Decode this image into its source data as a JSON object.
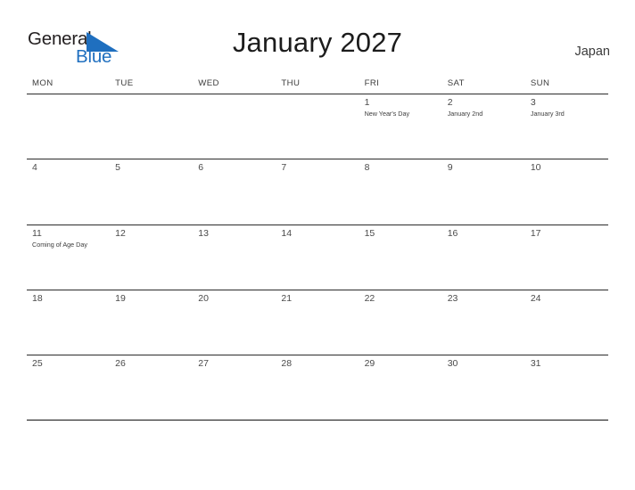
{
  "brand": {
    "name_part1": "General",
    "name_part2": "Blue",
    "triangle_icon": "blue-triangle-icon",
    "blue_color": "#1f6fbf",
    "dark_color": "#231f20"
  },
  "header": {
    "title": "January 2027",
    "country": "Japan"
  },
  "calendar": {
    "month": "January",
    "year": "2027",
    "weekday_headers": [
      "MON",
      "TUE",
      "WED",
      "THU",
      "FRI",
      "SAT",
      "SUN"
    ],
    "weeks": [
      [
        {
          "day": "",
          "event": ""
        },
        {
          "day": "",
          "event": ""
        },
        {
          "day": "",
          "event": ""
        },
        {
          "day": "",
          "event": ""
        },
        {
          "day": "1",
          "event": "New Year's Day"
        },
        {
          "day": "2",
          "event": "January 2nd"
        },
        {
          "day": "3",
          "event": "January 3rd"
        }
      ],
      [
        {
          "day": "4",
          "event": ""
        },
        {
          "day": "5",
          "event": ""
        },
        {
          "day": "6",
          "event": ""
        },
        {
          "day": "7",
          "event": ""
        },
        {
          "day": "8",
          "event": ""
        },
        {
          "day": "9",
          "event": ""
        },
        {
          "day": "10",
          "event": ""
        }
      ],
      [
        {
          "day": "11",
          "event": "Coming of Age Day"
        },
        {
          "day": "12",
          "event": ""
        },
        {
          "day": "13",
          "event": ""
        },
        {
          "day": "14",
          "event": ""
        },
        {
          "day": "15",
          "event": ""
        },
        {
          "day": "16",
          "event": ""
        },
        {
          "day": "17",
          "event": ""
        }
      ],
      [
        {
          "day": "18",
          "event": ""
        },
        {
          "day": "19",
          "event": ""
        },
        {
          "day": "20",
          "event": ""
        },
        {
          "day": "21",
          "event": ""
        },
        {
          "day": "22",
          "event": ""
        },
        {
          "day": "23",
          "event": ""
        },
        {
          "day": "24",
          "event": ""
        }
      ],
      [
        {
          "day": "25",
          "event": ""
        },
        {
          "day": "26",
          "event": ""
        },
        {
          "day": "27",
          "event": ""
        },
        {
          "day": "28",
          "event": ""
        },
        {
          "day": "29",
          "event": ""
        },
        {
          "day": "30",
          "event": ""
        },
        {
          "day": "31",
          "event": ""
        }
      ]
    ]
  }
}
